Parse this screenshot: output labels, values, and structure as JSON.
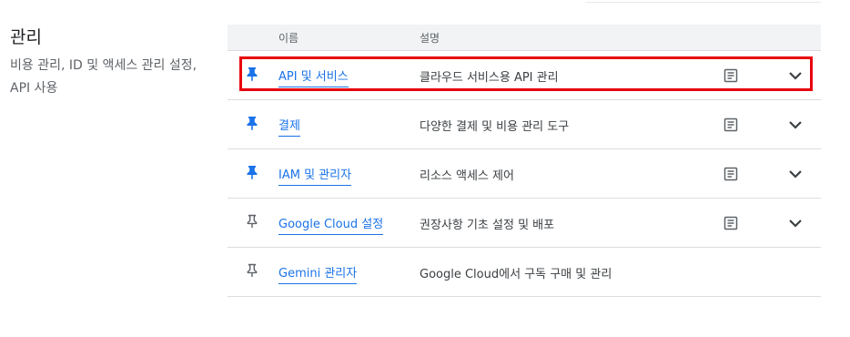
{
  "section": {
    "title": "관리",
    "description": "비용 관리, ID 및 액세스 관리 설정, API 사용"
  },
  "table": {
    "headers": {
      "name": "이름",
      "description": "설명"
    },
    "rows": [
      {
        "name": "API 및 서비스",
        "description": "클라우드 서비스용 API 관리",
        "pinned": true,
        "has_docs": true,
        "expandable": true,
        "highlighted": true
      },
      {
        "name": "결제",
        "description": "다양한 결제 및 비용 관리 도구",
        "pinned": true,
        "has_docs": true,
        "expandable": true,
        "highlighted": false
      },
      {
        "name": "IAM 및 관리자",
        "description": "리소스 액세스 제어",
        "pinned": true,
        "has_docs": true,
        "expandable": true,
        "highlighted": false
      },
      {
        "name": "Google Cloud 설정",
        "description": "권장사항 기초 설정 및 배포",
        "pinned": false,
        "has_docs": true,
        "expandable": true,
        "highlighted": false
      },
      {
        "name": "Gemini 관리자",
        "description": "Google Cloud에서 구독 구매 및 관리",
        "pinned": false,
        "has_docs": false,
        "expandable": false,
        "highlighted": false
      }
    ]
  },
  "colors": {
    "link": "#1a73e8",
    "pin_filled": "#1a73e8",
    "pin_outline": "#5f6368",
    "highlight": "#e8000c"
  }
}
